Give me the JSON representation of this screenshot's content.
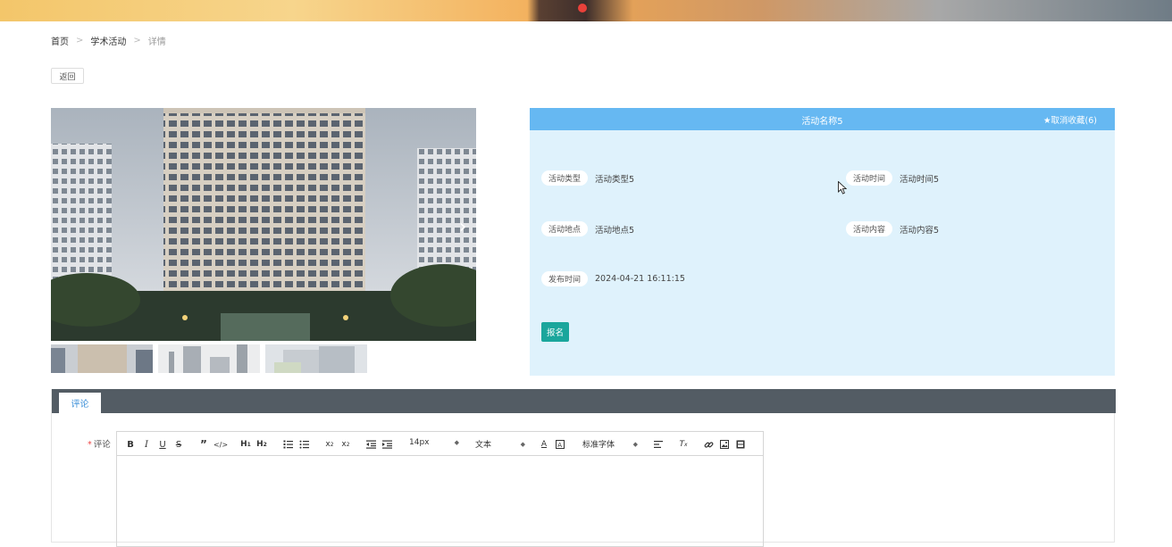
{
  "breadcrumb": {
    "home": "首页",
    "section": "学术活动",
    "current": "详情",
    "separator": ">"
  },
  "back_button": "返回",
  "activity": {
    "title": "活动名称5",
    "favorite": "★取消收藏(6)",
    "fields": {
      "type": {
        "label": "活动类型",
        "value": "活动类型5"
      },
      "time": {
        "label": "活动时间",
        "value": "活动时间5"
      },
      "location": {
        "label": "活动地点",
        "value": "活动地点5"
      },
      "content": {
        "label": "活动内容",
        "value": "活动内容5"
      },
      "published": {
        "label": "发布时间",
        "value": "2024-04-21 16:11:15"
      }
    },
    "signup_button": "报名"
  },
  "comments": {
    "tab": "评论",
    "label": "评论",
    "required_mark": "*",
    "toolbar": {
      "font_size": "14px",
      "header": "文本",
      "font_family": "标准字体"
    }
  },
  "colors": {
    "header_blue": "#66b8f2",
    "panel_bg": "#dff2fc",
    "signup_green": "#1aa69c",
    "tab_bar": "#535c64",
    "tab_text": "#3b8fd8"
  }
}
